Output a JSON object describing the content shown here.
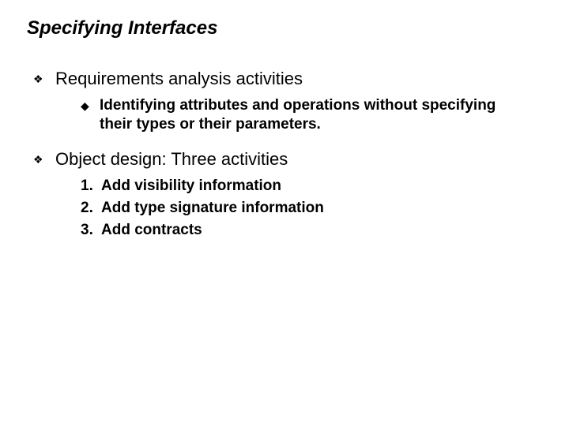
{
  "title": "Specifying Interfaces",
  "bullets": [
    {
      "text": "Requirements analysis activities",
      "sub": [
        "Identifying attributes and operations without specifying their types or their parameters."
      ],
      "numbered": []
    },
    {
      "text": "Object design: Three activities",
      "sub": [],
      "numbered": [
        "Add visibility information",
        "Add type signature information",
        "Add contracts"
      ]
    }
  ],
  "glyphs": {
    "diamond": "❖",
    "sub": "◆"
  }
}
